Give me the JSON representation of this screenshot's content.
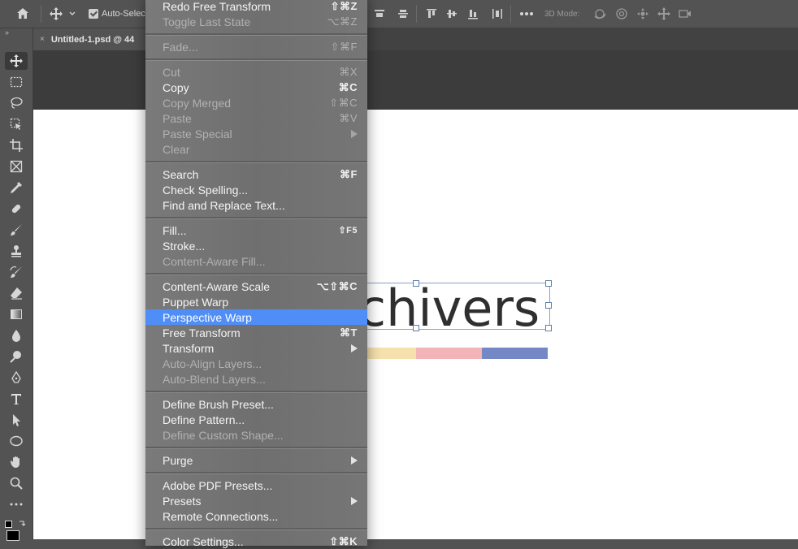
{
  "options_bar": {
    "auto_select_label": "Auto-Selec",
    "three_d_mode_label": "3D Mode:"
  },
  "document": {
    "tab_title": "Untitled-1.psd @ 44",
    "close_glyph": "×",
    "canvas_text": "chivers",
    "stripe_colors": [
      "#f6e1ad",
      "#f3b4b8",
      "#7388c4"
    ]
  },
  "edit_menu": {
    "items": [
      {
        "label": "Redo Free Transform",
        "shortcut": "⇧⌘Z",
        "disabled": false
      },
      {
        "label": "Toggle Last State",
        "shortcut": "⌥⌘Z",
        "disabled": true
      },
      {
        "label": "Fade...",
        "shortcut": "⇧⌘F",
        "disabled": true
      },
      {
        "label": "Cut",
        "shortcut": "⌘X",
        "disabled": true
      },
      {
        "label": "Copy",
        "shortcut": "⌘C",
        "disabled": false
      },
      {
        "label": "Copy Merged",
        "shortcut": "⇧⌘C",
        "disabled": true
      },
      {
        "label": "Paste",
        "shortcut": "⌘V",
        "disabled": true
      },
      {
        "label": "Paste Special",
        "shortcut": "",
        "disabled": true,
        "submenu": true
      },
      {
        "label": "Clear",
        "shortcut": "",
        "disabled": true
      },
      {
        "label": "Search",
        "shortcut": "⌘F",
        "disabled": false
      },
      {
        "label": "Check Spelling...",
        "shortcut": "",
        "disabled": false
      },
      {
        "label": "Find and Replace Text...",
        "shortcut": "",
        "disabled": false
      },
      {
        "label": "Fill...",
        "shortcut": "⇧F5",
        "disabled": false
      },
      {
        "label": "Stroke...",
        "shortcut": "",
        "disabled": false
      },
      {
        "label": "Content-Aware Fill...",
        "shortcut": "",
        "disabled": true
      },
      {
        "label": "Content-Aware Scale",
        "shortcut": "⌥⇧⌘C",
        "disabled": false
      },
      {
        "label": "Puppet Warp",
        "shortcut": "",
        "disabled": false
      },
      {
        "label": "Perspective Warp",
        "shortcut": "",
        "disabled": false,
        "highlighted": true
      },
      {
        "label": "Free Transform",
        "shortcut": "⌘T",
        "disabled": false
      },
      {
        "label": "Transform",
        "shortcut": "",
        "disabled": false,
        "submenu": true
      },
      {
        "label": "Auto-Align Layers...",
        "shortcut": "",
        "disabled": true
      },
      {
        "label": "Auto-Blend Layers...",
        "shortcut": "",
        "disabled": true
      },
      {
        "label": "Define Brush Preset...",
        "shortcut": "",
        "disabled": false
      },
      {
        "label": "Define Pattern...",
        "shortcut": "",
        "disabled": false
      },
      {
        "label": "Define Custom Shape...",
        "shortcut": "",
        "disabled": true
      },
      {
        "label": "Purge",
        "shortcut": "",
        "disabled": false,
        "submenu": true
      },
      {
        "label": "Adobe PDF Presets...",
        "shortcut": "",
        "disabled": false
      },
      {
        "label": "Presets",
        "shortcut": "",
        "disabled": false,
        "submenu": true
      },
      {
        "label": "Remote Connections...",
        "shortcut": "",
        "disabled": false
      },
      {
        "label": "Color Settings...",
        "shortcut": "⇧⌘K",
        "disabled": false
      }
    ]
  },
  "icons": {
    "toolbar": [
      "move-icon",
      "marquee-icon",
      "lasso-icon",
      "object-select-icon",
      "crop-icon",
      "frame-icon",
      "eyedropper-icon",
      "healing-brush-icon",
      "brush-icon",
      "clone-stamp-icon",
      "history-brush-icon",
      "eraser-icon",
      "gradient-icon",
      "blur-icon",
      "dodge-icon",
      "pen-icon",
      "type-icon",
      "path-select-icon",
      "ellipse-icon",
      "hand-icon",
      "zoom-icon",
      "more-tools-icon"
    ]
  }
}
